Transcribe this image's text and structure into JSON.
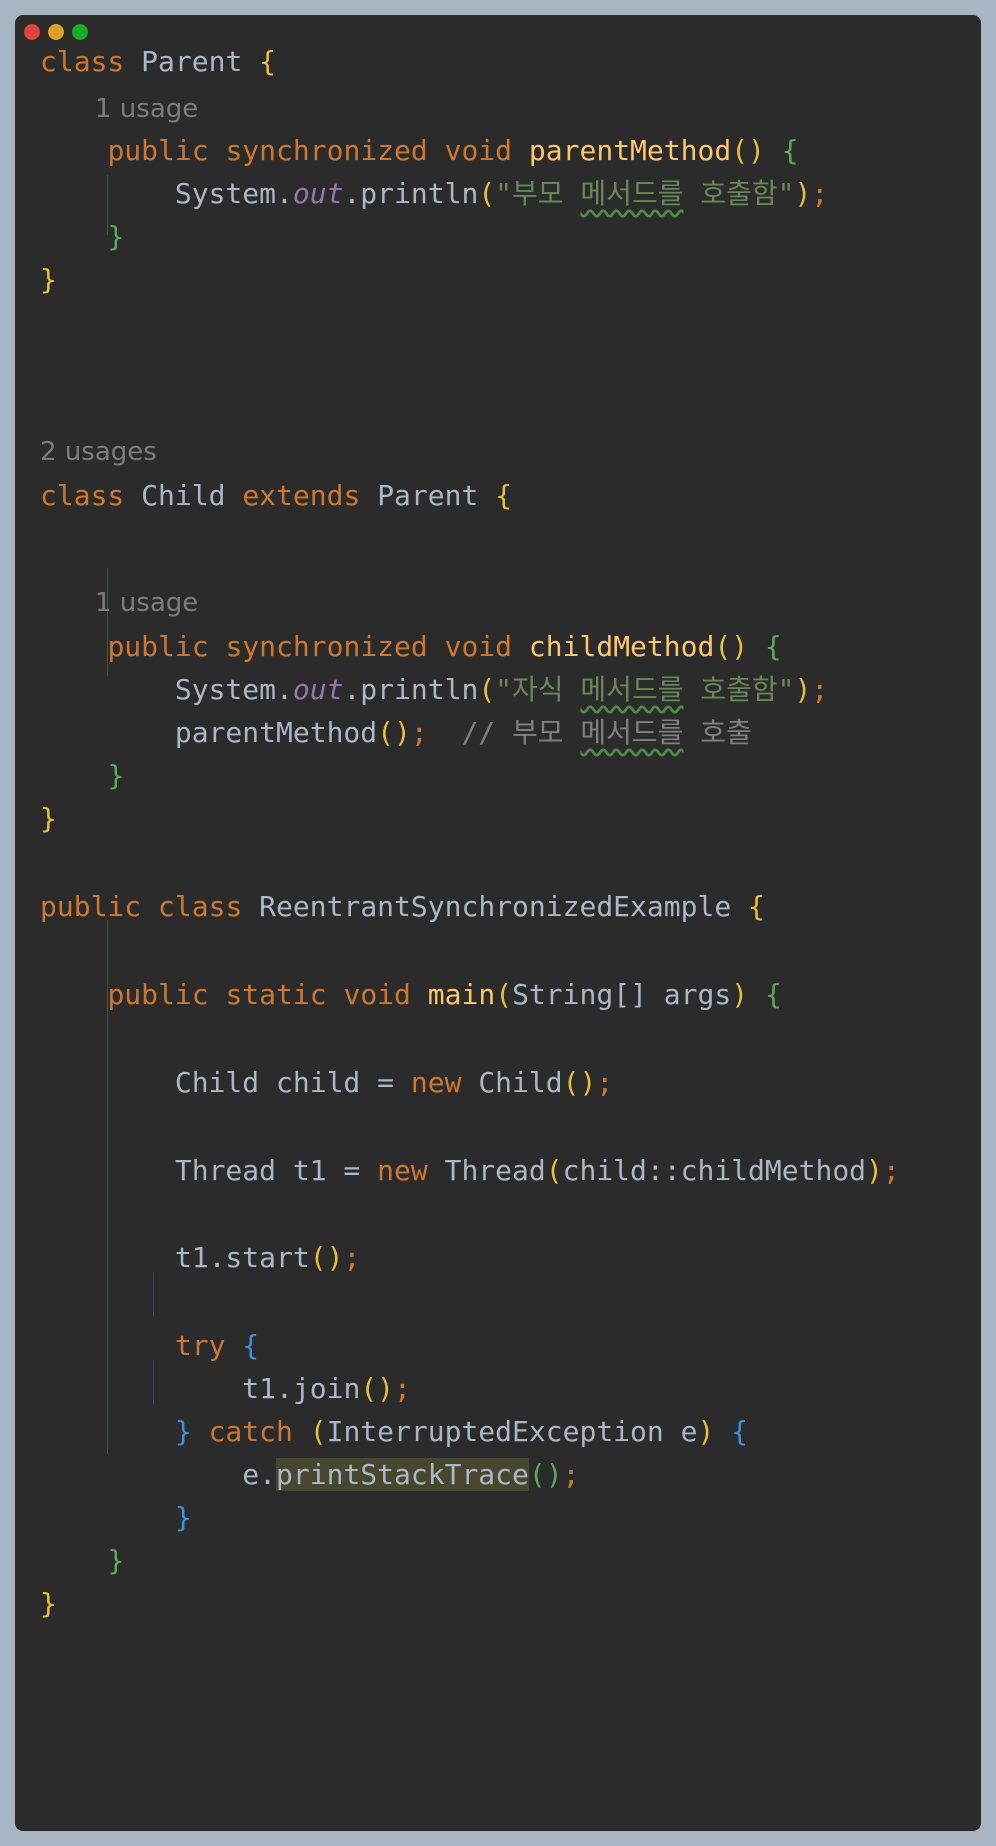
{
  "editor": {
    "hints": {
      "parent_method_usages": "1 usage",
      "child_class_usages": "2 usages",
      "child_method_usages": "1 usage"
    },
    "code": {
      "kw_class": "class",
      "kw_public": "public",
      "kw_synchronized": "synchronized",
      "kw_void": "void",
      "kw_static": "static",
      "kw_extends": "extends",
      "kw_new": "new",
      "kw_try": "try",
      "kw_catch": "catch",
      "parent_class": "Parent",
      "child_class": "Child",
      "main_class": "ReentrantSynchronizedExample",
      "parent_method": "parentMethod",
      "child_method": "childMethod",
      "main_method": "main",
      "system": "System.",
      "out_field": "out",
      "println": ".println",
      "str_parent_open": "\"부모 ",
      "str_parent_typo": "메서드를",
      "str_parent_close": " 호출함\"",
      "str_child_open": "\"자식 ",
      "str_child_typo": "메서드를",
      "str_child_close": " 호출함\"",
      "call_parent_method": "parentMethod",
      "comment_open": "// 부모 ",
      "comment_typo": "메서드를",
      "comment_close": " 호출",
      "main_params": "String[] args",
      "child_decl": "Child child = ",
      "child_ctor": "Child",
      "thread_decl": "Thread t1 = ",
      "thread_ctor": "Thread",
      "method_ref": "child::childMethod",
      "t1_start": "t1.start",
      "t1_join": "t1.join",
      "exception_param": "InterruptedException e",
      "e_dot": "e.",
      "print_stack_trace": "printStackTrace"
    }
  },
  "colors": {
    "background": "#2b2b2b",
    "keyword": "#cc7832",
    "function": "#ffc66d",
    "string": "#6a8759",
    "field": "#9876aa",
    "comment": "#808080",
    "text": "#a9b7c6"
  }
}
